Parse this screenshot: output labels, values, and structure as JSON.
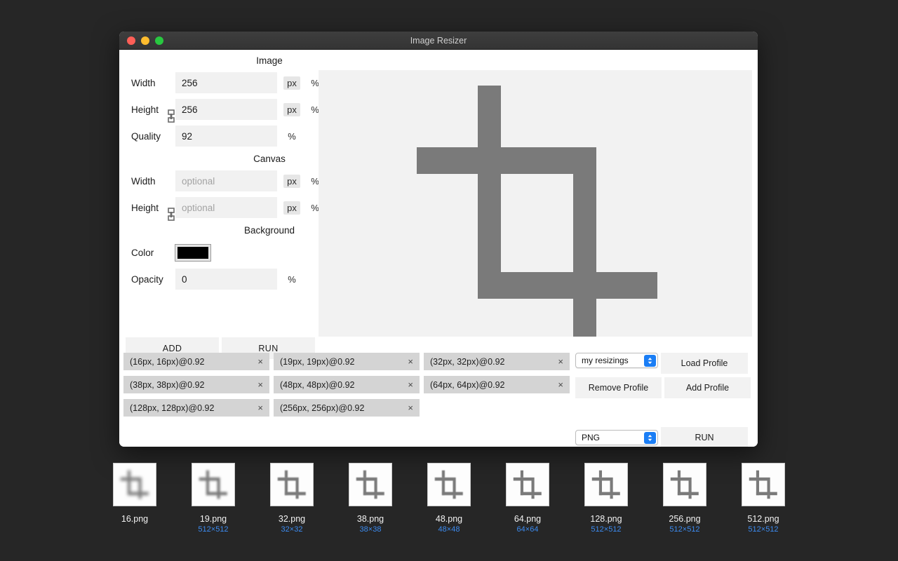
{
  "window": {
    "title": "Image Resizer",
    "traffic_lights": [
      "close-button",
      "minimize-button",
      "zoom-button"
    ]
  },
  "sections": {
    "image": {
      "heading": "Image",
      "fields": [
        {
          "label": "Width",
          "value": "256",
          "placeholder": "",
          "units": [
            "px",
            "%"
          ],
          "selected_unit": "px"
        },
        {
          "label": "Height",
          "value": "256",
          "placeholder": "",
          "units": [
            "px",
            "%"
          ],
          "selected_unit": "px"
        },
        {
          "label": "Quality",
          "value": "92",
          "placeholder": "",
          "units": [
            "%"
          ],
          "selected_unit": ""
        }
      ]
    },
    "canvas": {
      "heading": "Canvas",
      "fields": [
        {
          "label": "Width",
          "value": "",
          "placeholder": "optional",
          "units": [
            "px",
            "%"
          ],
          "selected_unit": "px"
        },
        {
          "label": "Height",
          "value": "",
          "placeholder": "optional",
          "units": [
            "px",
            "%"
          ],
          "selected_unit": "px"
        }
      ]
    },
    "background": {
      "heading": "Background",
      "color_label": "Color",
      "color_value": "#000000",
      "opacity_label": "Opacity",
      "opacity_value": "0",
      "opacity_unit": "%"
    }
  },
  "actions": {
    "add_label": "ADD",
    "run_label": "RUN"
  },
  "resize_list": [
    {
      "label": "(16px, 16px)@0.92",
      "remove": "×"
    },
    {
      "label": "(19px, 19px)@0.92",
      "remove": "×"
    },
    {
      "label": "(32px, 32px)@0.92",
      "remove": "×"
    },
    {
      "label": "(38px, 38px)@0.92",
      "remove": "×"
    },
    {
      "label": "(48px, 48px)@0.92",
      "remove": "×"
    },
    {
      "label": "(64px, 64px)@0.92",
      "remove": "×"
    },
    {
      "label": "(128px, 128px)@0.92",
      "remove": "×"
    },
    {
      "label": "(256px, 256px)@0.92",
      "remove": "×"
    }
  ],
  "profiles": {
    "selected": "my resizings",
    "load_label": "Load Profile",
    "remove_label": "Remove Profile",
    "add_label": "Add Profile"
  },
  "export": {
    "format": "PNG",
    "run_label": "RUN"
  },
  "thumbnails": [
    {
      "name": "16.png",
      "dimensions": "",
      "blur": 2.4
    },
    {
      "name": "19.png",
      "dimensions": "512×512",
      "blur": 1.6
    },
    {
      "name": "32.png",
      "dimensions": "32×32",
      "blur": 0.9
    },
    {
      "name": "38.png",
      "dimensions": "38×38",
      "blur": 0.6
    },
    {
      "name": "48.png",
      "dimensions": "48×48",
      "blur": 0.4
    },
    {
      "name": "64.png",
      "dimensions": "64×64",
      "blur": 0.25
    },
    {
      "name": "128.png",
      "dimensions": "512×512",
      "blur": 0.1
    },
    {
      "name": "256.png",
      "dimensions": "512×512",
      "blur": 0
    },
    {
      "name": "512.png",
      "dimensions": "512×512",
      "blur": 0
    }
  ],
  "colors": {
    "desktop": "#262626",
    "accent_blue": "#1b7ef5",
    "dimension_text": "#3c8bf0",
    "icon_gray": "#7a7a7a",
    "panel_gray": "#f2f2f2",
    "chip_gray": "#d4d4d4"
  },
  "preview": {
    "icon": "crop-icon"
  }
}
